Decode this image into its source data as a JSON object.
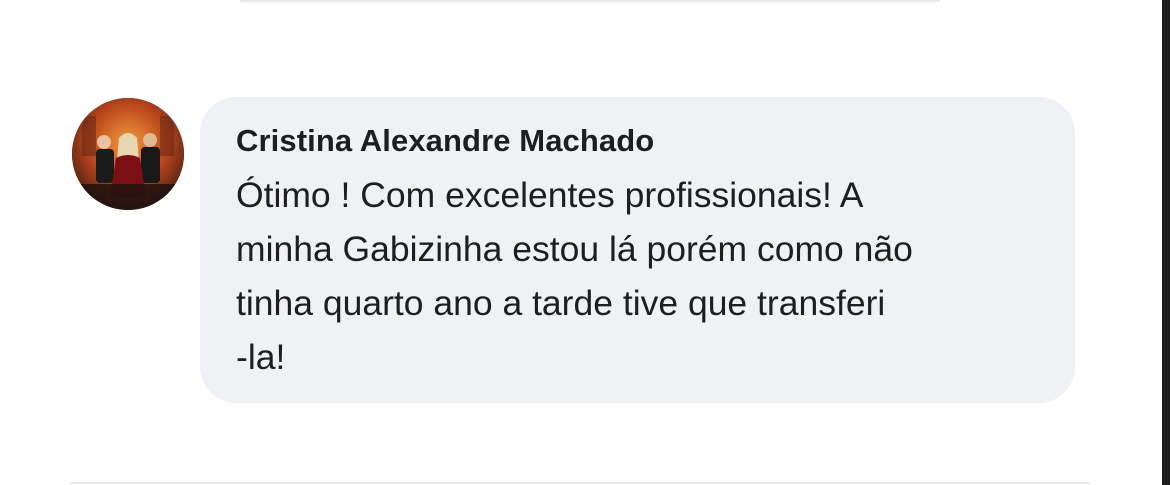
{
  "comment": {
    "author_name": "Cristina Alexandre Machado",
    "text": "Ótimo ! Com excelentes profissionais! A\nminha Gabizinha estou lá porém como não\ntinha quarto ano a tarde tive que transferi\n-la!"
  },
  "colors": {
    "bubble_background": "#f0f1f5",
    "text": "#1c1e21",
    "avatar_bg": "#2a1812"
  }
}
